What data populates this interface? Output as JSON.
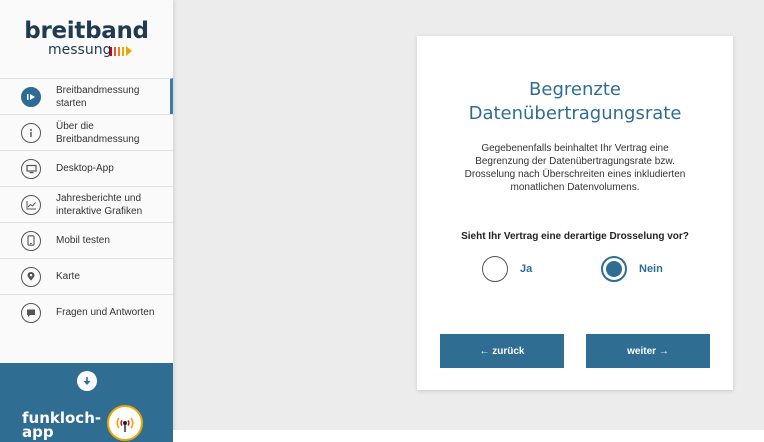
{
  "logo": {
    "line1": "breitband",
    "line2": "messung"
  },
  "brand_colors": {
    "primary": "#2f6d93",
    "accent": "#f0a500",
    "logo_bars": [
      "#d0021b",
      "#e4572e",
      "#f07b1a",
      "#f0a500"
    ]
  },
  "sidebar": {
    "items": [
      {
        "label": "Breitbandmessung starten",
        "icon": "play-icon",
        "active": true
      },
      {
        "label": "Über die Breitbandmessung",
        "icon": "info-icon",
        "active": false
      },
      {
        "label": "Desktop-App",
        "icon": "monitor-icon",
        "active": false
      },
      {
        "label": "Jahresberichte und interaktive Grafiken",
        "icon": "chart-icon",
        "active": false
      },
      {
        "label": "Mobil testen",
        "icon": "mobile-icon",
        "active": false
      },
      {
        "label": "Karte",
        "icon": "map-pin-icon",
        "active": false
      },
      {
        "label": "Fragen und Antworten",
        "icon": "chat-icon",
        "active": false
      }
    ],
    "funkloch": {
      "line1": "funkloch-",
      "line2": "app",
      "down_icon": "arrow-down-icon",
      "logo_icon": "antenna-icon"
    }
  },
  "card": {
    "title_line1": "Begrenzte",
    "title_line2": "Datenübertragungsrate",
    "description": "Gegebenenfalls beinhaltet Ihr Vertrag eine Begrenzung der Datenübertragungsrate bzw. Drosselung nach Überschreiten eines inkludierten monatlichen Datenvolumens.",
    "question": "Sieht Ihr Vertrag eine derartige Drosselung vor?",
    "options": [
      {
        "label": "Ja",
        "selected": false
      },
      {
        "label": "Nein",
        "selected": true
      }
    ],
    "back_label": "← zurück",
    "next_label": "weiter →"
  }
}
